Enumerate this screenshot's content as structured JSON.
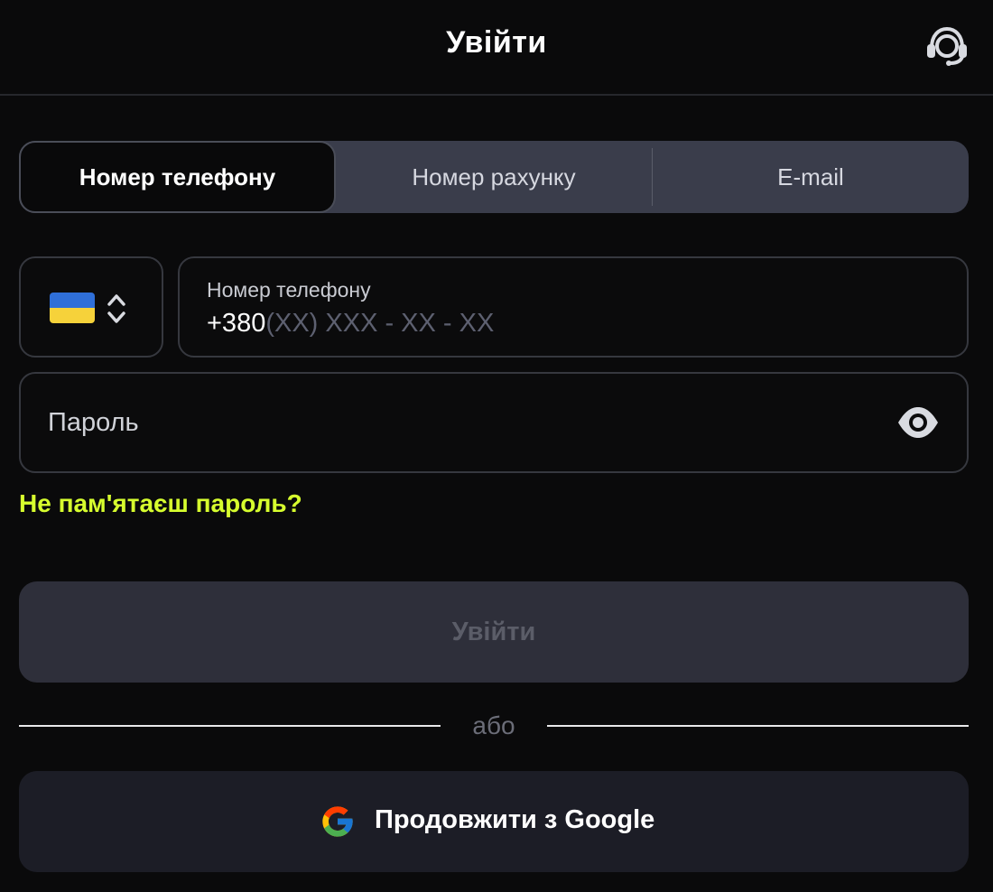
{
  "header": {
    "title": "Увійти",
    "support_icon": "headset-support-icon"
  },
  "tabs": [
    {
      "label": "Номер телефону",
      "active": true
    },
    {
      "label": "Номер рахунку",
      "active": false
    },
    {
      "label": "E-mail",
      "active": false
    }
  ],
  "country": {
    "flag": "ukraine-flag",
    "flag_colors": [
      "#2f6fd8",
      "#f6d23a"
    ]
  },
  "phone": {
    "label": "Номер телефону",
    "prefix": "+380",
    "mask": "(XX) XXX - XX - XX"
  },
  "password": {
    "placeholder": "Пароль",
    "toggle_icon": "eye-icon"
  },
  "forgot_password": "Не пам'ятаєш пароль?",
  "login_button": "Увійти",
  "separator": "або",
  "google_button": {
    "label": "Продовжити з Google",
    "icon": "google-icon"
  },
  "colors": {
    "background": "#0a0a0b",
    "accent": "#d7ff2e",
    "tabs_bg": "#3a3d4b",
    "disabled_button_bg": "#2e2f3a",
    "google_button_bg": "#1c1d26"
  }
}
